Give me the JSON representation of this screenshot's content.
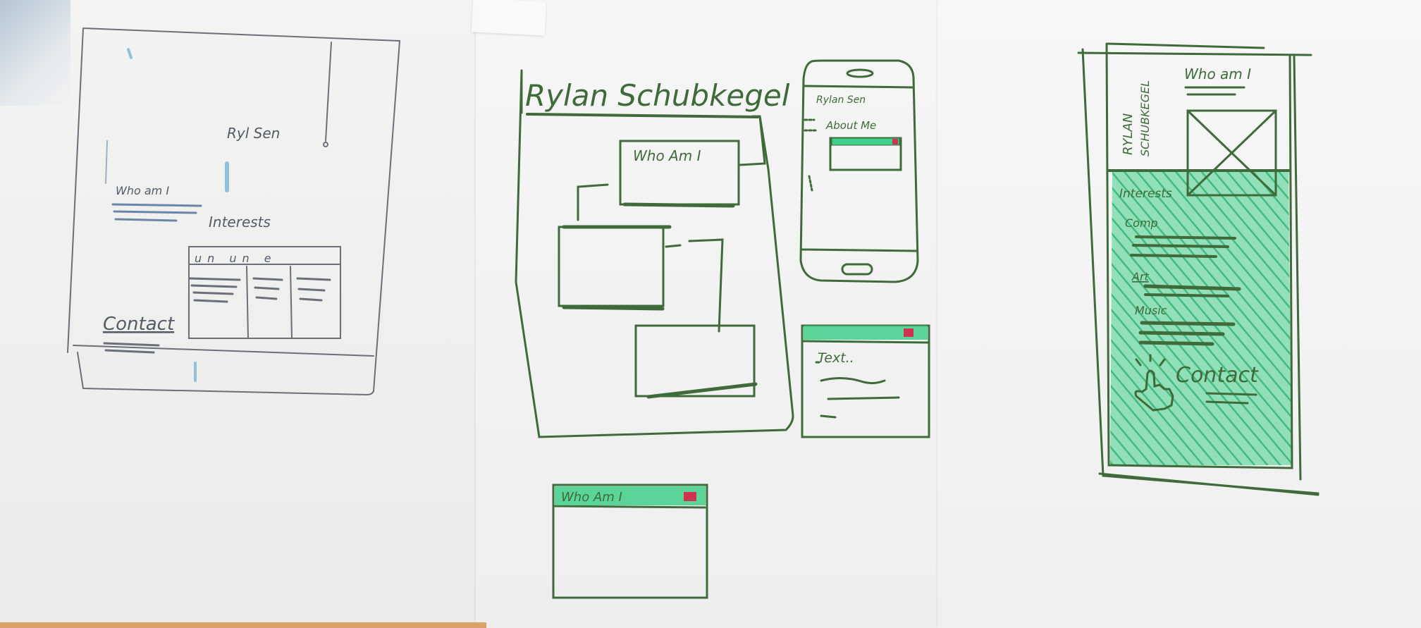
{
  "left_sketch": {
    "name": "Ryl Sen",
    "who_am_i": "Who am I",
    "interests": "Interests",
    "table_head": "un un e",
    "contact": "Contact"
  },
  "middle_sketch": {
    "title": "Rylan Schubkegel",
    "who_am_i_box": "Who Am I",
    "phone_name": "Rylan Sen",
    "phone_about": "About Me",
    "text_window": "Text..",
    "who_am_i_window": "Who Am I"
  },
  "right_sketch": {
    "name_vertical_1": "RYLAN",
    "name_vertical_2": "SCHUBKEGEL",
    "who_am_i": "Who am I",
    "interests": "Interests",
    "comp": "Comp",
    "art": "Art",
    "music": "Music",
    "contact": "Contact"
  },
  "colors": {
    "pencil": "#555c66",
    "marker_green": "#3f6b3a",
    "highlight_green": "#3fcf8a",
    "accent_red": "#d0334f",
    "sky_blue": "#7fb6d9"
  }
}
